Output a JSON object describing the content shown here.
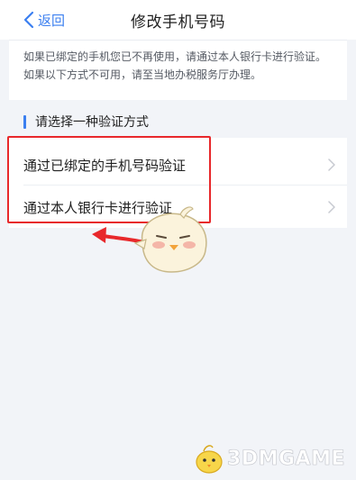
{
  "nav": {
    "back_label": "返回",
    "title": "修改手机号码"
  },
  "notice": {
    "text": "如果已绑定的手机您已不再使用，请通过本人银行卡进行验证。如果以下方式不可用，请至当地办税服务厅办理。"
  },
  "section": {
    "label": "请选择一种验证方式"
  },
  "options": [
    {
      "label": "通过已绑定的手机号码验证"
    },
    {
      "label": "通过本人银行卡进行验证"
    }
  ],
  "watermark": {
    "text": "3DMGAME"
  },
  "colors": {
    "accent": "#3b7ff0",
    "highlight": "#e8282b",
    "background": "#f2f4f8"
  }
}
